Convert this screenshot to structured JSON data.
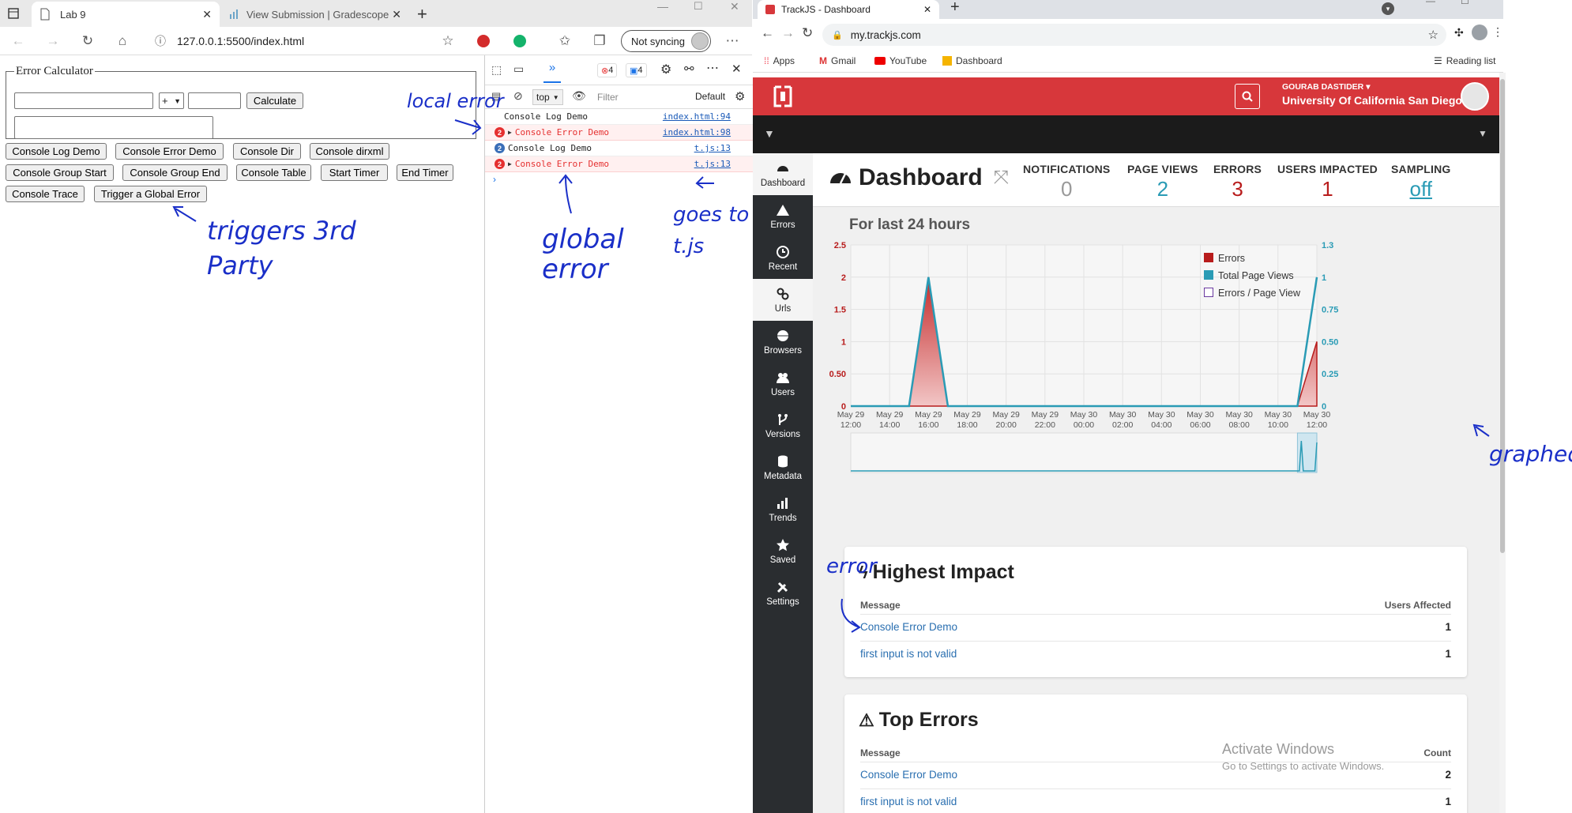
{
  "edge": {
    "tabs": [
      {
        "label": "Lab 9"
      },
      {
        "label": "View Submission | Gradescope"
      }
    ],
    "address": "127.0.0.1:5500/index.html",
    "sync_label": "Not syncing"
  },
  "page": {
    "legend": "Error Calculator",
    "operator": "+",
    "calculate_label": "Calculate",
    "buttons": [
      "Console Log Demo",
      "Console Error Demo",
      "Console Dir",
      "Console dirxml",
      "Console Group Start",
      "Console Group End",
      "Console Table",
      "Start Timer",
      "End Timer",
      "Console Trace",
      "Trigger a Global Error"
    ]
  },
  "devtools": {
    "error_count": "4",
    "message_count": "4",
    "context": "top",
    "filter_placeholder": "Filter",
    "level": "Default",
    "rows": [
      {
        "text": "Console Log Demo",
        "source": "index.html:94",
        "type": "log",
        "badge": ""
      },
      {
        "text": "Console Error Demo",
        "source": "index.html:98",
        "type": "error",
        "badge": "2"
      },
      {
        "text": "Console Log Demo",
        "source": "t.js:13",
        "type": "info",
        "badge": "2"
      },
      {
        "text": "Console Error Demo",
        "source": "t.js:13",
        "type": "error",
        "badge": "2"
      }
    ]
  },
  "chrome": {
    "tab_title": "TrackJS - Dashboard",
    "address": "my.trackjs.com",
    "bookmarks": [
      "Apps",
      "Gmail",
      "YouTube",
      "Dashboard"
    ],
    "reading_list": "Reading list"
  },
  "trackjs": {
    "user_name": "GOURAB DASTIDER",
    "org": "University Of California San Diego",
    "nav": [
      "Dashboard",
      "Errors",
      "Recent",
      "Urls",
      "Browsers",
      "Users",
      "Versions",
      "Metadata",
      "Trends",
      "Saved",
      "Settings"
    ],
    "title": "Dashboard",
    "stats": [
      {
        "label": "NOTIFICATIONS",
        "value": "0",
        "color": "#999999"
      },
      {
        "label": "PAGE VIEWS",
        "value": "2",
        "color": "#2a9bb5"
      },
      {
        "label": "ERRORS",
        "value": "3",
        "color": "#b81c1c"
      },
      {
        "label": "USERS IMPACTED",
        "value": "1",
        "color": "#b81c1c"
      },
      {
        "label": "SAMPLING",
        "value": "off",
        "color": "#2a9bb5"
      }
    ],
    "chart_heading": "For last 24 hours",
    "highest_impact": {
      "title": "Highest Impact",
      "col_message": "Message",
      "col_count": "Users Affected",
      "rows": [
        {
          "message": "Console Error Demo",
          "count": "1"
        },
        {
          "message": "first input is not valid",
          "count": "1"
        }
      ]
    },
    "top_errors": {
      "title": "Top Errors",
      "col_message": "Message",
      "col_count": "Count",
      "rows": [
        {
          "message": "Console Error Demo",
          "count": "2"
        },
        {
          "message": "first input is not valid",
          "count": "1"
        }
      ]
    },
    "watermark_title": "Activate Windows",
    "watermark_sub": "Go to Settings to activate Windows."
  },
  "annotations": {
    "local_error": "local error",
    "global_error": "global error",
    "goes_to": "goes to t.js",
    "triggers": "triggers 3rd Party",
    "graphed": "graphed",
    "error": "error"
  },
  "chart_data": {
    "type": "area",
    "title": "For last 24 hours",
    "categories": [
      "May 29 12:00",
      "May 29 14:00",
      "May 29 16:00",
      "May 29 18:00",
      "May 29 20:00",
      "May 29 22:00",
      "May 30 00:00",
      "May 30 02:00",
      "May 30 04:00",
      "May 30 06:00",
      "May 30 08:00",
      "May 30 10:00",
      "May 30 12:00"
    ],
    "series": [
      {
        "name": "Errors",
        "axis": "left",
        "color": "#b81c1c",
        "x": [
          0,
          1.5,
          2,
          2.5,
          11.5,
          12
        ],
        "values": [
          0,
          0,
          2,
          0,
          0,
          1
        ]
      },
      {
        "name": "Total Page Views",
        "axis": "right",
        "color": "#2a9bb5",
        "x": [
          0,
          1.5,
          2,
          2.5,
          11.5,
          12
        ],
        "values": [
          0,
          0,
          1,
          0,
          0,
          1
        ]
      },
      {
        "name": "Errors / Page View",
        "axis": "right",
        "color": "#6a3aa0",
        "values": []
      }
    ],
    "y_left_ticks": [
      "0",
      "0.50",
      "1",
      "1.5",
      "2",
      "2.5"
    ],
    "y_left_range": [
      0,
      2.5
    ],
    "y_right_ticks": [
      "0",
      "0.25",
      "0.50",
      "0.75",
      "1",
      "1.3"
    ],
    "y_right_range": [
      0,
      1.25
    ],
    "legend": "top-right",
    "grid": true
  }
}
